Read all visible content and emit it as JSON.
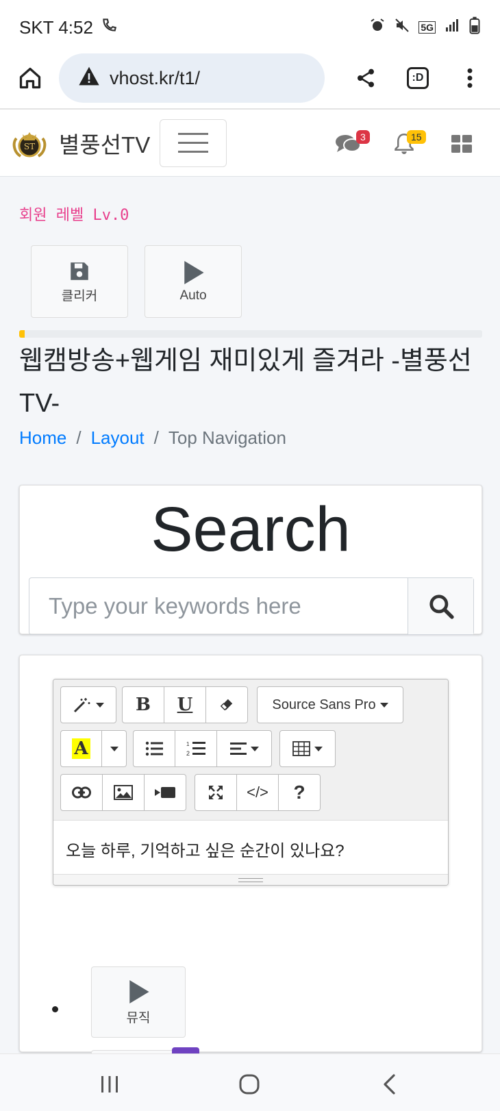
{
  "status_bar": {
    "carrier_time": "SKT 4:52",
    "network": "5G"
  },
  "browser": {
    "url": "vhost.kr/t1/",
    "tabs_label": ":D"
  },
  "navbar": {
    "brand": "별풍선TV",
    "logo_text": "ST",
    "messages_count": "3",
    "notifications_count": "15"
  },
  "member_level": "회원 레벨 Lv.0",
  "quick_buttons": {
    "clicker": "클리커",
    "auto": "Auto"
  },
  "progress_percent": 1.2,
  "page_title": "웹캠방송+웹게임 재미있게 즐겨라 -별풍선TV-",
  "breadcrumb": {
    "home": "Home",
    "layout": "Layout",
    "current": "Top Navigation",
    "sep": "/"
  },
  "search": {
    "title": "Search",
    "placeholder": "Type your keywords here"
  },
  "editor": {
    "font_name": "Source Sans Pro",
    "bold": "B",
    "underline": "U",
    "highlight": "A",
    "code": "</>",
    "help": "?",
    "content": "오늘 하루, 기억하고 싶은 순간이 있나요?"
  },
  "list": {
    "music": "뮤직"
  },
  "colors": {
    "link": "#007bff",
    "level_pink": "#e83e8c",
    "badge_red": "#dc3545",
    "badge_yellow": "#ffc107",
    "peek_purple": "#6f42c1"
  }
}
